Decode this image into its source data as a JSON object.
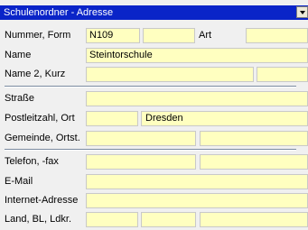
{
  "window": {
    "title": "Schulenordner - Adresse",
    "dropdown_icon": "chevron-down-icon"
  },
  "labels": {
    "nummer_form": "Nummer, Form",
    "art": "Art",
    "name": "Name",
    "name2_kurz": "Name 2, Kurz",
    "strasse": "Straße",
    "plz_ort": "Postleitzahl, Ort",
    "gemeinde_ortst": "Gemeinde, Ortst.",
    "telefon_fax": "Telefon, -fax",
    "email": "E-Mail",
    "internet": "Internet-Adresse",
    "land_bl_ldkr": "Land, BL, Ldkr."
  },
  "values": {
    "nummer": "N109",
    "form": "",
    "art": "",
    "name": "Steintorschule",
    "name2": "",
    "kurz": "",
    "strasse": "",
    "plz": "",
    "ort": "Dresden",
    "gemeinde": "",
    "ortsteil": "",
    "telefon": "",
    "fax": "",
    "email": "",
    "internet": "",
    "land": "",
    "bundesland": "",
    "landkreis": ""
  },
  "colors": {
    "title_bg": "#0a24c8",
    "field_bg": "#ffffc0",
    "panel_bg": "#f0f0f0"
  }
}
